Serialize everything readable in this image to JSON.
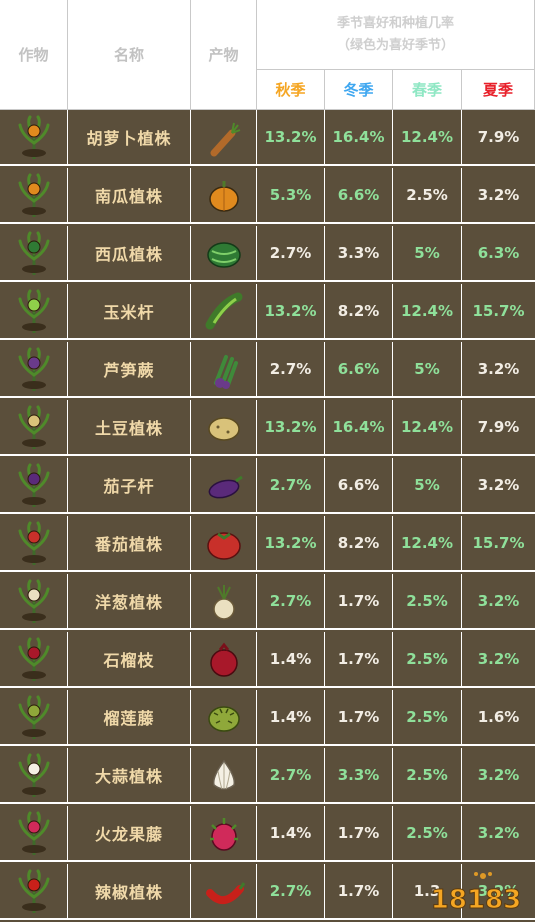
{
  "header": {
    "col_crop": "作物",
    "col_name": "名称",
    "col_product": "产物",
    "title_line1": "季节喜好和种植几率",
    "title_line2": "（绿色为喜好季节）",
    "seasons": [
      "秋季",
      "冬季",
      "春季",
      "夏季"
    ],
    "season_colors": [
      "#f5a623",
      "#3fa7f0",
      "#8fe7c4",
      "#e8202a"
    ]
  },
  "colors": {
    "row_bg": "#5b4f3b",
    "name_text": "#f0d9a9",
    "favored_text": "#8fe09a",
    "normal_text": "#f2ede4",
    "grid": "#ffffff"
  },
  "rows": [
    {
      "name": "胡萝卜植株",
      "plant_icon": "carrot-plant-icon",
      "product_icon": "carrot-icon",
      "rates": [
        "13.2%",
        "16.4%",
        "12.4%",
        "7.9%"
      ],
      "favored": [
        true,
        true,
        true,
        false
      ]
    },
    {
      "name": "南瓜植株",
      "plant_icon": "pumpkin-plant-icon",
      "product_icon": "pumpkin-icon",
      "rates": [
        "5.3%",
        "6.6%",
        "2.5%",
        "3.2%"
      ],
      "favored": [
        true,
        true,
        false,
        false
      ]
    },
    {
      "name": "西瓜植株",
      "plant_icon": "watermelon-plant-icon",
      "product_icon": "watermelon-icon",
      "rates": [
        "2.7%",
        "3.3%",
        "5%",
        "6.3%"
      ],
      "favored": [
        false,
        false,
        true,
        true
      ]
    },
    {
      "name": "玉米杆",
      "plant_icon": "corn-plant-icon",
      "product_icon": "corn-icon",
      "rates": [
        "13.2%",
        "8.2%",
        "12.4%",
        "15.7%"
      ],
      "favored": [
        true,
        false,
        true,
        true
      ]
    },
    {
      "name": "芦笋蕨",
      "plant_icon": "asparagus-plant-icon",
      "product_icon": "asparagus-icon",
      "rates": [
        "2.7%",
        "6.6%",
        "5%",
        "3.2%"
      ],
      "favored": [
        false,
        true,
        true,
        false
      ]
    },
    {
      "name": "土豆植株",
      "plant_icon": "potato-plant-icon",
      "product_icon": "potato-icon",
      "rates": [
        "13.2%",
        "16.4%",
        "12.4%",
        "7.9%"
      ],
      "favored": [
        true,
        true,
        true,
        false
      ]
    },
    {
      "name": "茄子杆",
      "plant_icon": "eggplant-plant-icon",
      "product_icon": "eggplant-icon",
      "rates": [
        "2.7%",
        "6.6%",
        "5%",
        "3.2%"
      ],
      "favored": [
        true,
        false,
        true,
        false
      ]
    },
    {
      "name": "番茄植株",
      "plant_icon": "tomato-plant-icon",
      "product_icon": "tomato-icon",
      "rates": [
        "13.2%",
        "8.2%",
        "12.4%",
        "15.7%"
      ],
      "favored": [
        true,
        false,
        true,
        true
      ]
    },
    {
      "name": "洋葱植株",
      "plant_icon": "onion-plant-icon",
      "product_icon": "onion-icon",
      "rates": [
        "2.7%",
        "1.7%",
        "2.5%",
        "3.2%"
      ],
      "favored": [
        true,
        false,
        true,
        true
      ]
    },
    {
      "name": "石榴枝",
      "plant_icon": "pomegranate-plant-icon",
      "product_icon": "pomegranate-icon",
      "rates": [
        "1.4%",
        "1.7%",
        "2.5%",
        "3.2%"
      ],
      "favored": [
        false,
        false,
        true,
        true
      ]
    },
    {
      "name": "榴莲藤",
      "plant_icon": "durian-plant-icon",
      "product_icon": "durian-icon",
      "rates": [
        "1.4%",
        "1.7%",
        "2.5%",
        "1.6%"
      ],
      "favored": [
        false,
        false,
        true,
        false
      ]
    },
    {
      "name": "大蒜植株",
      "plant_icon": "garlic-plant-icon",
      "product_icon": "garlic-icon",
      "rates": [
        "2.7%",
        "3.3%",
        "2.5%",
        "3.2%"
      ],
      "favored": [
        true,
        true,
        true,
        true
      ]
    },
    {
      "name": "火龙果藤",
      "plant_icon": "dragonfruit-plant-icon",
      "product_icon": "dragonfruit-icon",
      "rates": [
        "1.4%",
        "1.7%",
        "2.5%",
        "3.2%"
      ],
      "favored": [
        false,
        false,
        true,
        true
      ]
    },
    {
      "name": "辣椒植株",
      "plant_icon": "pepper-plant-icon",
      "product_icon": "pepper-icon",
      "rates": [
        "2.7%",
        "1.7%",
        "1.3",
        "3.2%"
      ],
      "favored": [
        true,
        false,
        false,
        true
      ]
    }
  ],
  "watermark": {
    "text": "18183"
  }
}
